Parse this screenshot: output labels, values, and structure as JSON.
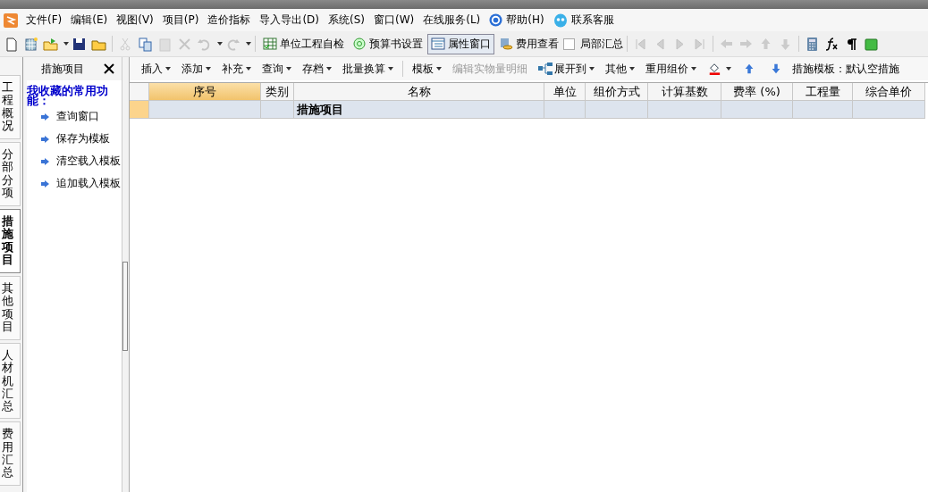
{
  "menu": [
    {
      "label": "文件(F)"
    },
    {
      "label": "编辑(E)"
    },
    {
      "label": "视图(V)"
    },
    {
      "label": "项目(P)"
    },
    {
      "label": "造价指标"
    },
    {
      "label": "导入导出(D)"
    },
    {
      "label": "系统(S)"
    },
    {
      "label": "窗口(W)"
    },
    {
      "label": "在线服务(L)"
    },
    {
      "label": "帮助(H)",
      "kind": "help"
    },
    {
      "label": "联系客服",
      "kind": "service"
    }
  ],
  "toolbar": [
    {
      "kind": "icon",
      "disabled": false
    },
    {
      "kind": "icon",
      "disabled": false
    },
    {
      "kind": "icon",
      "disabled": false,
      "dropdown": true
    },
    {
      "kind": "icon",
      "disabled": false
    },
    {
      "kind": "icon",
      "disabled": false
    },
    {
      "kind": "sep"
    },
    {
      "kind": "icon",
      "disabled": true
    },
    {
      "kind": "icon",
      "disabled": false
    },
    {
      "kind": "icon",
      "disabled": true
    },
    {
      "kind": "icon",
      "disabled": true
    },
    {
      "kind": "icon",
      "disabled": true,
      "dropdown": true
    },
    {
      "kind": "icon",
      "disabled": true,
      "dropdown": true
    },
    {
      "kind": "sep"
    },
    {
      "kind": "button",
      "label": "单位工程自检",
      "selected": false
    },
    {
      "kind": "button",
      "label": "预算书设置",
      "selected": false
    },
    {
      "kind": "button",
      "label": "属性窗口",
      "selected": true
    },
    {
      "kind": "button",
      "label": "费用查看",
      "selected": false
    },
    {
      "kind": "check",
      "label": "局部汇总",
      "checked": false
    },
    {
      "kind": "sep"
    },
    {
      "kind": "icon",
      "disabled": true
    },
    {
      "kind": "icon",
      "disabled": true
    },
    {
      "kind": "icon",
      "disabled": true
    },
    {
      "kind": "icon",
      "disabled": true
    },
    {
      "kind": "sep"
    },
    {
      "kind": "icon",
      "disabled": true
    },
    {
      "kind": "icon",
      "disabled": true
    },
    {
      "kind": "icon",
      "disabled": true
    },
    {
      "kind": "icon",
      "disabled": true
    },
    {
      "kind": "sep"
    },
    {
      "kind": "icon",
      "disabled": false
    },
    {
      "kind": "icon",
      "disabled": false
    },
    {
      "kind": "icon",
      "disabled": false
    },
    {
      "kind": "icon",
      "disabled": false
    }
  ],
  "side_tabs": [
    {
      "label": "工程概况",
      "selected": false
    },
    {
      "label": "分部分项",
      "selected": false
    },
    {
      "label": "措施项目",
      "selected": true
    },
    {
      "label": "其他项目",
      "selected": false
    },
    {
      "label": "人材机汇总",
      "selected": false
    },
    {
      "label": "费用汇总",
      "selected": false
    }
  ],
  "panel": {
    "title": "措施项目",
    "favorites_title": "我收藏的常用功能：",
    "items": [
      "查询窗口",
      "保存为模板",
      "清空载入模板",
      "追加载入模板"
    ]
  },
  "grid_toolbar": [
    {
      "label": "插入",
      "dropdown": true,
      "disabled": false
    },
    {
      "label": "添加",
      "dropdown": true,
      "disabled": false
    },
    {
      "label": "补充",
      "dropdown": true,
      "disabled": false
    },
    {
      "label": "查询",
      "dropdown": true,
      "disabled": false
    },
    {
      "label": "存档",
      "dropdown": true,
      "disabled": false
    },
    {
      "label": "批量换算",
      "dropdown": true,
      "disabled": false
    },
    {
      "kind": "sep"
    },
    {
      "label": "模板",
      "dropdown": true,
      "disabled": false
    },
    {
      "label": "编辑实物量明细",
      "disabled": true
    },
    {
      "label": "展开到",
      "dropdown": true,
      "disabled": false,
      "kind": "tree"
    },
    {
      "label": "其他",
      "dropdown": true,
      "disabled": false
    },
    {
      "label": "重用组价",
      "dropdown": true,
      "disabled": false
    },
    {
      "kind": "paint",
      "dropdown": true
    },
    {
      "kind": "up"
    },
    {
      "kind": "down"
    }
  ],
  "template_label": "措施模板：默认空措施",
  "table": {
    "columns": [
      {
        "label": "序号",
        "selected": true
      },
      {
        "label": "类别",
        "selected": false
      },
      {
        "label": "名称",
        "selected": false
      },
      {
        "label": "单位",
        "selected": false
      },
      {
        "label": "组价方式",
        "selected": false
      },
      {
        "label": "计算基数",
        "selected": false
      },
      {
        "label": "费率 (%)",
        "selected": false
      },
      {
        "label": "工程量",
        "selected": false
      },
      {
        "label": "综合单价",
        "selected": false
      }
    ],
    "rows": [
      {
        "selected": true,
        "cells": [
          "",
          "",
          "措施项目",
          "",
          "",
          "",
          "",
          "",
          ""
        ]
      }
    ]
  }
}
